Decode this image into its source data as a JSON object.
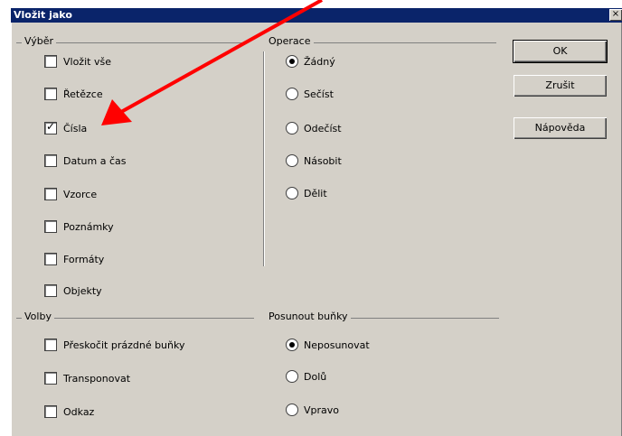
{
  "dialog": {
    "title": "Vložit jako",
    "close_glyph": "×"
  },
  "selection": {
    "group_label": "Výběr",
    "items": [
      {
        "label": "Vložit vše",
        "checked": false
      },
      {
        "label": "Řetězce",
        "checked": false
      },
      {
        "label": "Čísla",
        "checked": true
      },
      {
        "label": "Datum a čas",
        "checked": false
      },
      {
        "label": "Vzorce",
        "checked": false
      },
      {
        "label": "Poznámky",
        "checked": false
      },
      {
        "label": "Formáty",
        "checked": false
      },
      {
        "label": "Objekty",
        "checked": false
      }
    ]
  },
  "operations": {
    "group_label": "Operace",
    "items": [
      {
        "label": "Žádný",
        "selected": true
      },
      {
        "label": "Sečíst",
        "selected": false
      },
      {
        "label": "Odečíst",
        "selected": false
      },
      {
        "label": "Násobit",
        "selected": false
      },
      {
        "label": "Dělit",
        "selected": false
      }
    ]
  },
  "options": {
    "group_label": "Volby",
    "items": [
      {
        "label": "Přeskočit prázdné buňky",
        "checked": false
      },
      {
        "label": "Transponovat",
        "checked": false
      },
      {
        "label": "Odkaz",
        "checked": false
      }
    ]
  },
  "shift_cells": {
    "group_label": "Posunout buňky",
    "items": [
      {
        "label": "Neposunovat",
        "selected": true
      },
      {
        "label": "Dolů",
        "selected": false
      },
      {
        "label": "Vpravo",
        "selected": false
      }
    ]
  },
  "buttons": {
    "ok": "OK",
    "cancel": "Zrušit",
    "help": "Nápověda"
  },
  "colors": {
    "titlebar": "#0a246a",
    "dialog_bg": "#d4d0c8",
    "arrow": "#ff0000"
  }
}
